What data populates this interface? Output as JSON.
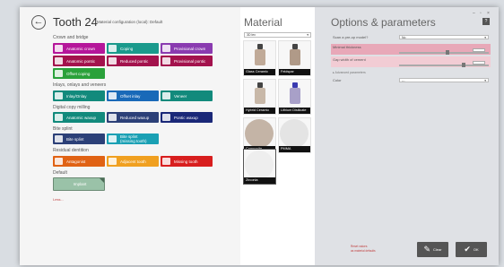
{
  "header": {
    "back_glyph": "←",
    "title": "Tooth 24",
    "subtitle": "Material configuration (local): Default"
  },
  "sections": [
    {
      "label": "Crown and bridge"
    },
    {
      "label": "Inlays, onlays and veneers"
    },
    {
      "label": "Digital copy milling"
    },
    {
      "label": "Bite splint"
    },
    {
      "label": "Residual dentition"
    },
    {
      "label": "Default"
    }
  ],
  "tiles": {
    "anatomic_crown": "Anatomic crown",
    "coping": "Coping",
    "provisional_crown": "Provisional crown",
    "anatomic_pontic": "Anatomic pontic",
    "reduced_pontic": "Reduced pontic",
    "provisional_pontic": "Provisional pontic",
    "offset_coping": "Offset coping",
    "inlay_onlay": "Inlay/Onlay",
    "offset_inlay": "Offset inlay",
    "veneer": "Veneer",
    "anatomic_waxup": "Anatomic waxup",
    "reduced_waxup": "Reduced waxup",
    "pontic_waxup": "Pontic waxup",
    "bite_splint": "Bite splint",
    "bite_splint_missing_1": "Bite splint",
    "bite_splint_missing_2": "(missing tooth)",
    "antagonist": "Antagonist",
    "adjacent_tooth": "Adjacent tooth",
    "missing_tooth": "Missing tooth",
    "implant": "Implant"
  },
  "more_link": "Less...",
  "material": {
    "title": "Material",
    "select_value": "3D lex",
    "items": [
      {
        "name": "Glass Ceramic"
      },
      {
        "name": "Feldspar"
      },
      {
        "name": "Hybrid Ceramic"
      },
      {
        "name": "Lithium Disilicate"
      },
      {
        "name": "Composite"
      },
      {
        "name": "PMMA"
      },
      {
        "name": "Zirconia"
      }
    ]
  },
  "options": {
    "title": "Options & parameters",
    "help_glyph": "?",
    "window_controls": [
      "–",
      "▫",
      "×"
    ],
    "rows": {
      "scan_label": "Scan a pre-op model?",
      "scan_value": "No",
      "thickness_label": "Minimal thickness",
      "gap_label": "Gap width of cement",
      "advanced_label": "▸ Advanced parameters",
      "color_label": "Color",
      "color_value": "---"
    },
    "bottom_link_1": "Reset values",
    "bottom_link_2": "as material defaults",
    "clear_button": "Clear",
    "ok_button": "OK"
  },
  "colors": {
    "accent_highlight": "#e8a8b8",
    "panel_bg": "#dfe1e5"
  }
}
